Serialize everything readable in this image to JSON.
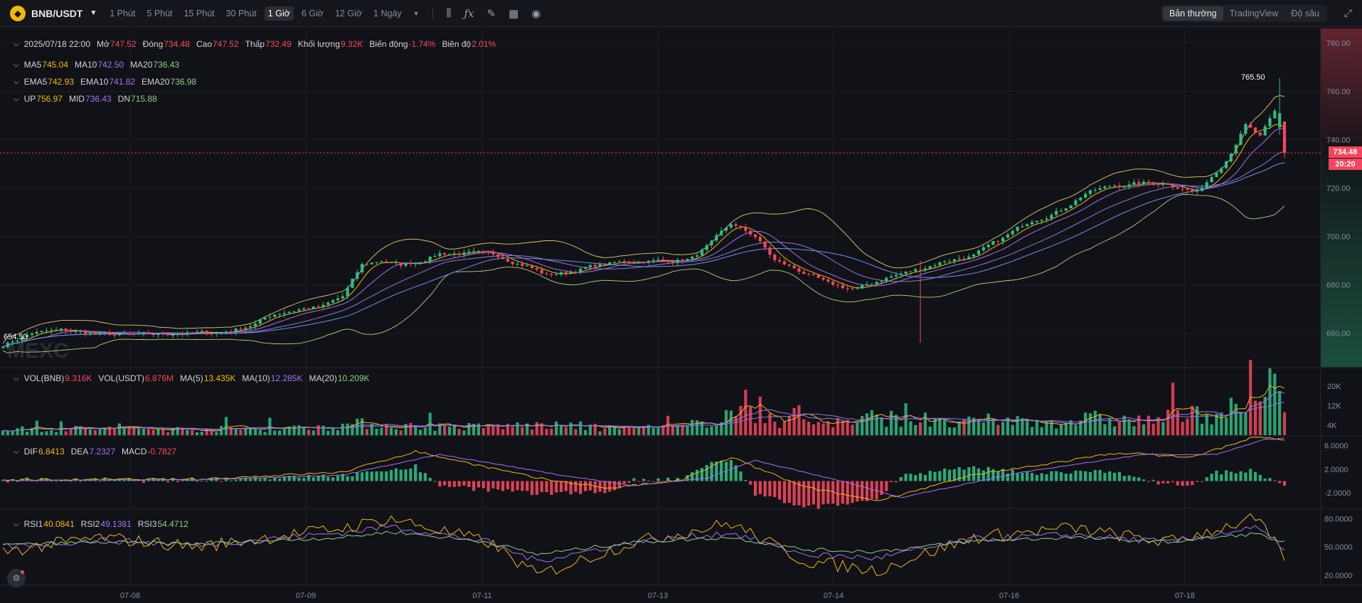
{
  "topbar": {
    "coin_icon": "bnb-coin-icon",
    "pair": "BNB/USDT",
    "timeframes": [
      "1 Phút",
      "5 Phút",
      "15 Phút",
      "30 Phút",
      "1 Giờ",
      "6 Giờ",
      "12 Giờ",
      "1 Ngày"
    ],
    "active_timeframe": "1 Giờ",
    "tools": [
      "candlestick-icon",
      "indicator-fx-icon",
      "pencil-icon",
      "layout-icon",
      "camera-icon"
    ],
    "views": [
      "Bản thường",
      "TradingView",
      "Độ sâu"
    ],
    "active_view": "Bản thường"
  },
  "ohlc": {
    "datetime": "2025/07/18 22:00",
    "open_label": "Mở",
    "open": "747.52",
    "close_label": "Đóng",
    "close": "734.48",
    "high_label": "Cao",
    "high": "747.52",
    "low_label": "Thấp",
    "low": "732.49",
    "volume_label": "Khối lượng",
    "volume": "9.32K",
    "change_label": "Biến động",
    "change": "-1.74%",
    "amplitude_label": "Biên độ",
    "amplitude": "2.01%"
  },
  "ma": {
    "ma5_label": "MA5",
    "ma5": "745.04",
    "ma10_label": "MA10",
    "ma10": "742.50",
    "ma20_label": "MA20",
    "ma20": "736.43"
  },
  "ema": {
    "ema5_label": "EMA5",
    "ema5": "742.93",
    "ema10_label": "EMA10",
    "ema10": "741.82",
    "ema20_label": "EMA20",
    "ema20": "736.98"
  },
  "boll": {
    "up_label": "UP",
    "up": "756.97",
    "mid_label": "MID",
    "mid": "736.43",
    "dn_label": "DN",
    "dn": "715.88"
  },
  "vol": {
    "bnb_label": "VOL(BNB)",
    "bnb": "9.316K",
    "usdt_label": "VOL(USDT)",
    "usdt": "6.876M",
    "ma5_label": "MA(5)",
    "ma5": "13.435K",
    "ma10_label": "MA(10)",
    "ma10": "12.285K",
    "ma20_label": "MA(20)",
    "ma20": "10.209K"
  },
  "macd": {
    "dif_label": "DIF",
    "dif": "6.8413",
    "dea_label": "DEA",
    "dea": "7.2327",
    "macd_label": "MACD",
    "macd": "-0.7827"
  },
  "rsi": {
    "rsi1_label": "RSI1",
    "rsi1": "40.0841",
    "rsi2_label": "RSI2",
    "rsi2": "49.1381",
    "rsi3_label": "RSI3",
    "rsi3": "54.4712"
  },
  "last_price": "734.48",
  "countdown": "20:20",
  "watermark": "MEXC",
  "colors": {
    "up": "#2ebd85",
    "down": "#f6465d",
    "ma5": "#f0b90b",
    "ma10": "#a371f7",
    "ma20": "#8ed081",
    "boll": "#e6c86e",
    "bg": "#111217"
  },
  "chart_data": [
    {
      "type": "candlestick",
      "pair": "BNB/USDT",
      "interval": "1 Giờ",
      "x_ticks": [
        "07-08",
        "07-09",
        "07-11",
        "07-13",
        "07-14",
        "07-16",
        "07-18"
      ],
      "y_ticks": [
        660,
        680,
        700,
        720,
        740,
        760,
        780
      ],
      "ylim": [
        646,
        786
      ],
      "annotations": {
        "high_marker": "765.50",
        "low_marker": "654.50"
      },
      "approx_close_path": [
        [
          0,
          655
        ],
        [
          6,
          660
        ],
        [
          12,
          661
        ],
        [
          18,
          660
        ],
        [
          24,
          659
        ],
        [
          30,
          659
        ],
        [
          36,
          660
        ],
        [
          42,
          660
        ],
        [
          47,
          661
        ],
        [
          52,
          664
        ],
        [
          56,
          668
        ],
        [
          61,
          670
        ],
        [
          66,
          671
        ],
        [
          70,
          675
        ],
        [
          74,
          688
        ],
        [
          78,
          690
        ],
        [
          82,
          688
        ],
        [
          86,
          690
        ],
        [
          90,
          693
        ],
        [
          96,
          693
        ],
        [
          102,
          692
        ],
        [
          108,
          688
        ],
        [
          112,
          684
        ],
        [
          116,
          685
        ],
        [
          120,
          687
        ],
        [
          126,
          689
        ],
        [
          132,
          690
        ],
        [
          138,
          690
        ],
        [
          142,
          691
        ],
        [
          146,
          697
        ],
        [
          150,
          705
        ],
        [
          155,
          700
        ],
        [
          159,
          690
        ],
        [
          165,
          685
        ],
        [
          170,
          680
        ],
        [
          176,
          678
        ],
        [
          182,
          683
        ],
        [
          188,
          686
        ],
        [
          194,
          690
        ],
        [
          200,
          692
        ],
        [
          206,
          699
        ],
        [
          212,
          707
        ],
        [
          218,
          711
        ],
        [
          223,
          718
        ],
        [
          229,
          721
        ],
        [
          235,
          722
        ],
        [
          240,
          722
        ],
        [
          246,
          718
        ],
        [
          252,
          732
        ],
        [
          256,
          746
        ],
        [
          259,
          741
        ],
        [
          262,
          751
        ],
        [
          264,
          734.48
        ]
      ]
    },
    {
      "type": "bar",
      "name": "VOL(BNB)",
      "y_ticks": [
        "4K",
        "12K",
        "20K"
      ],
      "ylim": [
        0,
        26000
      ],
      "approx_values": [
        [
          0,
          2500
        ],
        [
          20,
          2800
        ],
        [
          40,
          2500
        ],
        [
          60,
          3000
        ],
        [
          75,
          5000
        ],
        [
          80,
          4000
        ],
        [
          95,
          3500
        ],
        [
          110,
          4200
        ],
        [
          125,
          3000
        ],
        [
          140,
          3200
        ],
        [
          150,
          9500
        ],
        [
          160,
          6000
        ],
        [
          175,
          5500
        ],
        [
          180,
          8000
        ],
        [
          195,
          4500
        ],
        [
          205,
          6500
        ],
        [
          215,
          5500
        ],
        [
          225,
          7000
        ],
        [
          235,
          6000
        ],
        [
          250,
          10000
        ],
        [
          258,
          12000
        ],
        [
          262,
          25000
        ],
        [
          264,
          9316
        ]
      ]
    },
    {
      "type": "line",
      "name": "MACD",
      "y_ticks": [
        "-2.0000",
        "2.0000",
        "6.0000"
      ],
      "ylim": [
        -4.5,
        7.5
      ],
      "series": [
        {
          "name": "DIF",
          "approx_values": [
            [
              0,
              0.2
            ],
            [
              40,
              0.3
            ],
            [
              70,
              1.5
            ],
            [
              85,
              5.0
            ],
            [
              110,
              0.5
            ],
            [
              125,
              -1.2
            ],
            [
              140,
              0.2
            ],
            [
              150,
              4.0
            ],
            [
              165,
              -1.0
            ],
            [
              180,
              -3.3
            ],
            [
              200,
              1.0
            ],
            [
              230,
              4.8
            ],
            [
              245,
              4.0
            ],
            [
              258,
              7.5
            ],
            [
              264,
              6.8413
            ]
          ]
        },
        {
          "name": "DEA",
          "approx_values": [
            [
              0,
              0.1
            ],
            [
              40,
              0.2
            ],
            [
              70,
              1.0
            ],
            [
              90,
              4.5
            ],
            [
              115,
              1.0
            ],
            [
              130,
              -0.8
            ],
            [
              145,
              0.5
            ],
            [
              155,
              3.5
            ],
            [
              175,
              -0.5
            ],
            [
              185,
              -2.8
            ],
            [
              210,
              1.5
            ],
            [
              235,
              4.5
            ],
            [
              250,
              4.5
            ],
            [
              260,
              7.0
            ],
            [
              264,
              7.2327
            ]
          ]
        },
        {
          "name": "MACD",
          "approx_values": [
            [
              0,
              0.1
            ],
            [
              85,
              2.0
            ],
            [
              115,
              -1.0
            ],
            [
              150,
              1.5
            ],
            [
              175,
              -3.5
            ],
            [
              200,
              1.5
            ],
            [
              230,
              1.0
            ],
            [
              245,
              -1.5
            ],
            [
              256,
              4.5
            ],
            [
              264,
              -0.7827
            ]
          ]
        }
      ]
    },
    {
      "type": "line",
      "name": "RSI",
      "y_ticks": [
        "20.0000",
        "50.0000",
        "80.0000"
      ],
      "ylim": [
        10,
        90
      ],
      "series": [
        {
          "name": "RSI1",
          "approx_values": [
            [
              0,
              45
            ],
            [
              20,
              60
            ],
            [
              40,
              50
            ],
            [
              70,
              70
            ],
            [
              80,
              80
            ],
            [
              100,
              55
            ],
            [
              110,
              20
            ],
            [
              130,
              55
            ],
            [
              150,
              75
            ],
            [
              165,
              35
            ],
            [
              180,
              25
            ],
            [
              200,
              60
            ],
            [
              220,
              70
            ],
            [
              240,
              55
            ],
            [
              258,
              80
            ],
            [
              264,
              40.0841
            ]
          ]
        },
        {
          "name": "RSI2",
          "approx_values": [
            [
              0,
              50
            ],
            [
              20,
              57
            ],
            [
              40,
              52
            ],
            [
              70,
              65
            ],
            [
              80,
              72
            ],
            [
              100,
              55
            ],
            [
              110,
              35
            ],
            [
              130,
              55
            ],
            [
              150,
              65
            ],
            [
              165,
              42
            ],
            [
              180,
              38
            ],
            [
              200,
              58
            ],
            [
              220,
              63
            ],
            [
              240,
              55
            ],
            [
              258,
              70
            ],
            [
              264,
              49.1381
            ]
          ]
        },
        {
          "name": "RSI3",
          "approx_values": [
            [
              0,
              52
            ],
            [
              20,
              55
            ],
            [
              40,
              53
            ],
            [
              70,
              60
            ],
            [
              80,
              66
            ],
            [
              100,
              55
            ],
            [
              110,
              42
            ],
            [
              130,
              55
            ],
            [
              150,
              60
            ],
            [
              165,
              47
            ],
            [
              180,
              45
            ],
            [
              200,
              56
            ],
            [
              220,
              60
            ],
            [
              240,
              55
            ],
            [
              258,
              64
            ],
            [
              264,
              54.4712
            ]
          ]
        }
      ]
    }
  ]
}
